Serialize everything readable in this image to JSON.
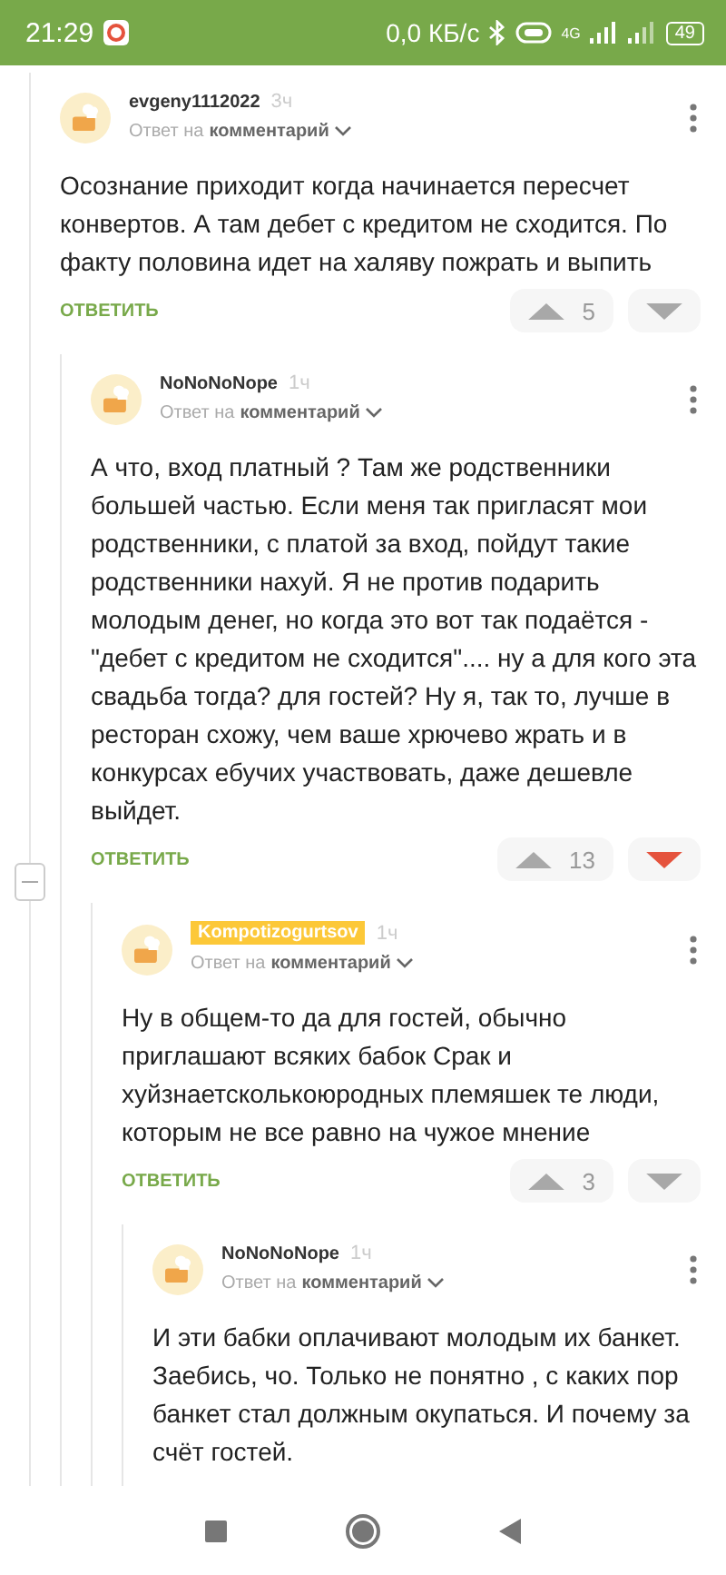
{
  "status_bar": {
    "time": "21:29",
    "net_speed": "0,0 КБ/с",
    "network_type": "4G",
    "battery": "49"
  },
  "comments": [
    {
      "author": "evgeny1112022",
      "author_highlighted": false,
      "age": "3ч",
      "reply_prefix": "Ответ на",
      "reply_target": "комментарий",
      "text": "Осознание приходит когда начинается пересчет конвертов. А там дебет с кредитом не сходится. По факту половина идет на халяву пожрать и выпить",
      "reply_label": "ОТВЕТИТЬ",
      "rating": "5",
      "downvoted": false,
      "children": [
        {
          "author": "NoNoNoNope",
          "author_highlighted": false,
          "age": "1ч",
          "reply_prefix": "Ответ на",
          "reply_target": "комментарий",
          "text": "А что, вход платный ? Там же родственники большей частью. Если меня так пригласят мои родственники, с платой за вход, пойдут такие родственники нахуй. Я не против подарить молодым денег, но когда это вот так подаётся - \"дебет с кредитом не сходится\".... ну а для кого эта свадьба тогда? для гостей? Ну я, так то, лучше в ресторан схожу, чем ваше хрючево жрать и в конкурсах ебучих участвовать, даже дешевле выйдет.",
          "reply_label": "ОТВЕТИТЬ",
          "rating": "13",
          "downvoted": true,
          "collapse_control": true,
          "children": [
            {
              "author": "Kompotizogurtsov",
              "author_highlighted": true,
              "age": "1ч",
              "reply_prefix": "Ответ на",
              "reply_target": "комментарий",
              "text": "Ну в общем-то да для гостей, обычно приглашают всяких бабок Срак и хуйзнаетсколькоюродных племяшек те люди, которым не все равно на чужое мнение",
              "reply_label": "ОТВЕТИТЬ",
              "rating": "3",
              "downvoted": false,
              "children": [
                {
                  "author": "NoNoNoNope",
                  "author_highlighted": false,
                  "age": "1ч",
                  "reply_prefix": "Ответ на",
                  "reply_target": "комментарий",
                  "text": "И эти бабки оплачивают молодым их банкет. Заебись, чо. Только не понятно , с каких пор банкет стал должным окупаться. И почему за счёт гостей."
                }
              ]
            }
          ]
        }
      ]
    }
  ]
}
